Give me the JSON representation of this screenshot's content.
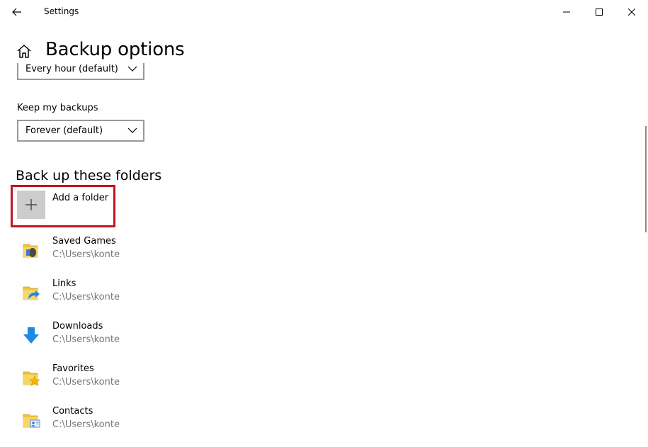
{
  "window": {
    "title": "Settings"
  },
  "header": {
    "page_title": "Backup options"
  },
  "backup_frequency": {
    "selected": "Every hour (default)"
  },
  "keep_backups": {
    "label": "Keep my backups",
    "selected": "Forever (default)"
  },
  "folders_section": {
    "title": "Back up these folders",
    "add_folder_label": "Add a folder",
    "highlight_color": "#c4141b",
    "items": [
      {
        "name": "Saved Games",
        "path": "C:\\Users\\konte",
        "icon": "saved-games-folder-icon"
      },
      {
        "name": "Links",
        "path": "C:\\Users\\konte",
        "icon": "links-folder-icon"
      },
      {
        "name": "Downloads",
        "path": "C:\\Users\\konte",
        "icon": "downloads-arrow-icon"
      },
      {
        "name": "Favorites",
        "path": "C:\\Users\\konte",
        "icon": "favorites-folder-icon"
      },
      {
        "name": "Contacts",
        "path": "C:\\Users\\konte",
        "icon": "contacts-folder-icon"
      }
    ]
  },
  "colors": {
    "folder_yellow": "#f0c33c",
    "accent_blue": "#1e88e5"
  }
}
